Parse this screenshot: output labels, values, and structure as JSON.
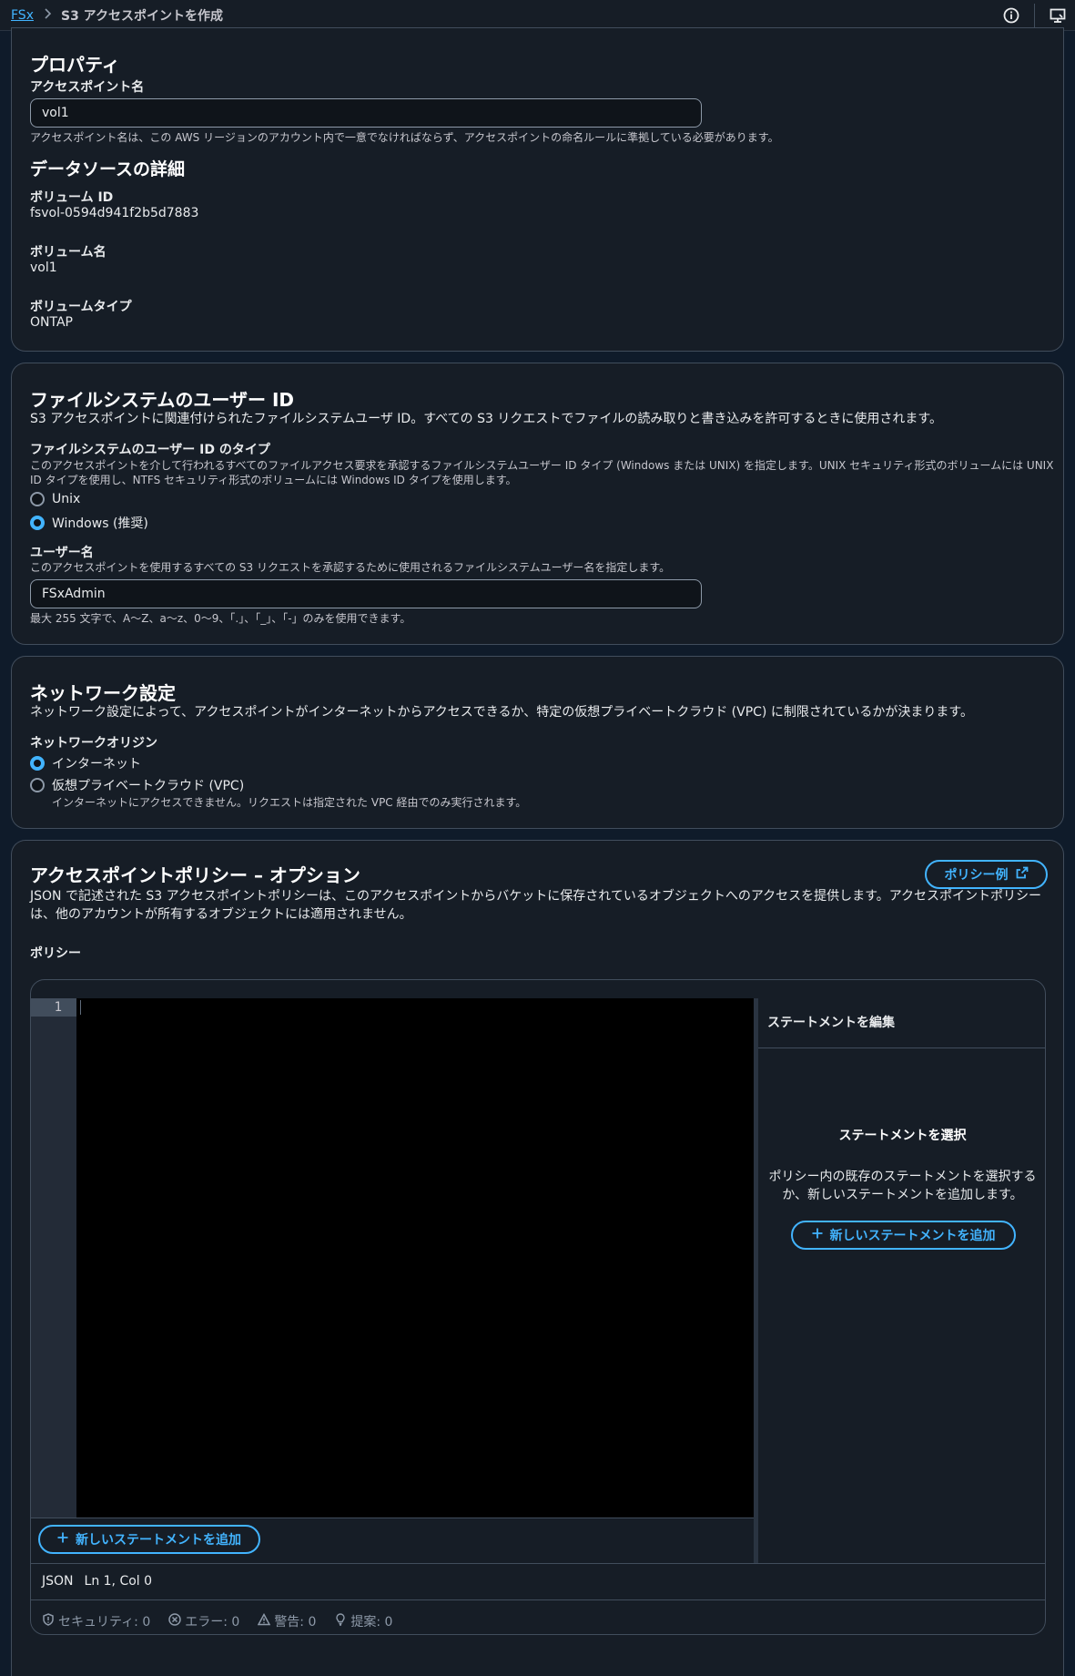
{
  "breadcrumb": {
    "root": "FSx",
    "current": "S3 アクセスポイントを作成"
  },
  "properties": {
    "title": "プロパティ",
    "name_label": "アクセスポイント名",
    "name_value": "vol1",
    "name_hint": "アクセスポイント名は、この AWS リージョンのアカウント内で一意でなければならず、アクセスポイントの命名ルールに準拠している必要があります。",
    "datasource_title": "データソースの詳細",
    "volume_id_label": "ボリューム ID",
    "volume_id_value": "fsvol-0594d941f2b5d7883",
    "volume_name_label": "ボリューム名",
    "volume_name_value": "vol1",
    "volume_type_label": "ボリュームタイプ",
    "volume_type_value": "ONTAP"
  },
  "fs_user": {
    "title": "ファイルシステムのユーザー ID",
    "description": "S3 アクセスポイントに関連付けられたファイルシステムユーザ ID。すべての S3 リクエストでファイルの読み取りと書き込みを許可するときに使用されます。",
    "type_label": "ファイルシステムのユーザー ID のタイプ",
    "type_desc_1": "このアクセスポイントを介して行われるすべてのファイルアクセス要求を承認するファイルシステムユーザー ID タイプ (Windows または UNIX) を指定します。UNIX セキュリティ形式のボリュームには UNIX",
    "type_desc_2": "ID タイプを使用し、NTFS セキュリティ形式のボリュームには Windows ID タイプを使用します。",
    "option_unix": "Unix",
    "option_windows": "Windows (推奨)",
    "username_label": "ユーザー名",
    "username_desc": "このアクセスポイントを使用するすべての S3 リクエストを承認するために使用されるファイルシステムユーザー名を指定します。",
    "username_value": "FSxAdmin",
    "username_hint": "最大 255 文字で、A〜Z、a〜z、0〜9、「.」、「_」、「-」のみを使用できます。"
  },
  "network": {
    "title": "ネットワーク設定",
    "description": "ネットワーク設定によって、アクセスポイントがインターネットからアクセスできるか、特定の仮想プライベートクラウド (VPC) に制限されているかが決まります。",
    "origin_label": "ネットワークオリジン",
    "option_internet": "インターネット",
    "option_vpc": "仮想プライベートクラウド (VPC)",
    "option_vpc_desc": "インターネットにアクセスできません。リクエストは指定された VPC 経由でのみ実行されます。"
  },
  "policy": {
    "title": "アクセスポイントポリシー – オプション",
    "example_button": "ポリシー例",
    "description_1": "JSON で記述された S3 アクセスポイントポリシーは、このアクセスポイントからバケットに保存されているオブジェクトへのアクセスを提供します。アクセスポイントポリシー",
    "description_2": "は、他のアカウントが所有するオブジェクトには適用されません。",
    "policy_label": "ポリシー",
    "line_number": "1",
    "edit_statement_title": "ステートメントを編集",
    "select_statement_title": "ステートメントを選択",
    "select_statement_desc": "ポリシー内の既存のステートメントを選択するか、新しいステートメントを追加します。",
    "add_statement": "新しいステートメントを追加",
    "mode": "JSON",
    "cursor_pos": "Ln 1, Col 0",
    "security": "セキュリティ: 0",
    "errors": "エラー: 0",
    "warnings": "警告: 0",
    "suggestions": "提案: 0"
  },
  "colors": {
    "accent": "#42b4ff",
    "card_bg": "#161d26",
    "border": "#414d5c"
  }
}
